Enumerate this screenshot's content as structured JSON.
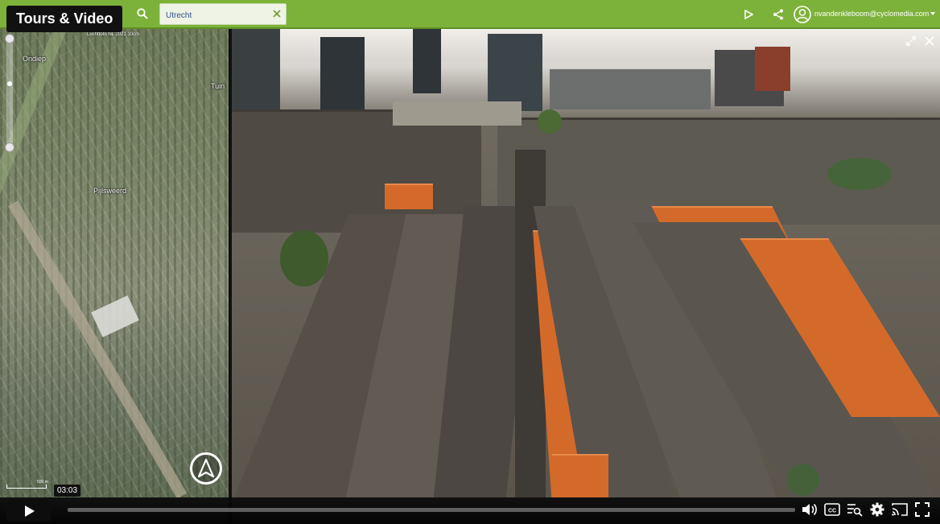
{
  "overlay": {
    "title": "Tours & Video"
  },
  "topbar": {
    "search": {
      "value": "Utrecht"
    },
    "user": {
      "email": "nvandenkleboom@cyclomedia.com"
    },
    "colors": {
      "bar": "#7db23a",
      "link": "#2d4f8a"
    }
  },
  "map": {
    "credit": "Luchtfoto NL 2021 10cm",
    "labels": {
      "ondiep": "Ondiep",
      "tuin": "Tuin",
      "pijlsweerd": "Pijlsweerd"
    },
    "scale": "500 m",
    "icons": {
      "compass": "compass-north-icon",
      "zoom_in": "zoom-in-icon",
      "zoom_out": "zoom-out-icon"
    }
  },
  "city_view": {
    "icons": {
      "expand": "expand-icon",
      "close": "close-icon"
    }
  },
  "video": {
    "time_tooltip": "03:03",
    "progress_fraction": 0.0,
    "icons": {
      "play": "play-icon",
      "volume": "volume-icon",
      "captions": "cc-icon",
      "transcript": "transcript-icon",
      "settings": "gear-icon",
      "cast": "cast-icon",
      "fullscreen": "fullscreen-icon"
    }
  }
}
